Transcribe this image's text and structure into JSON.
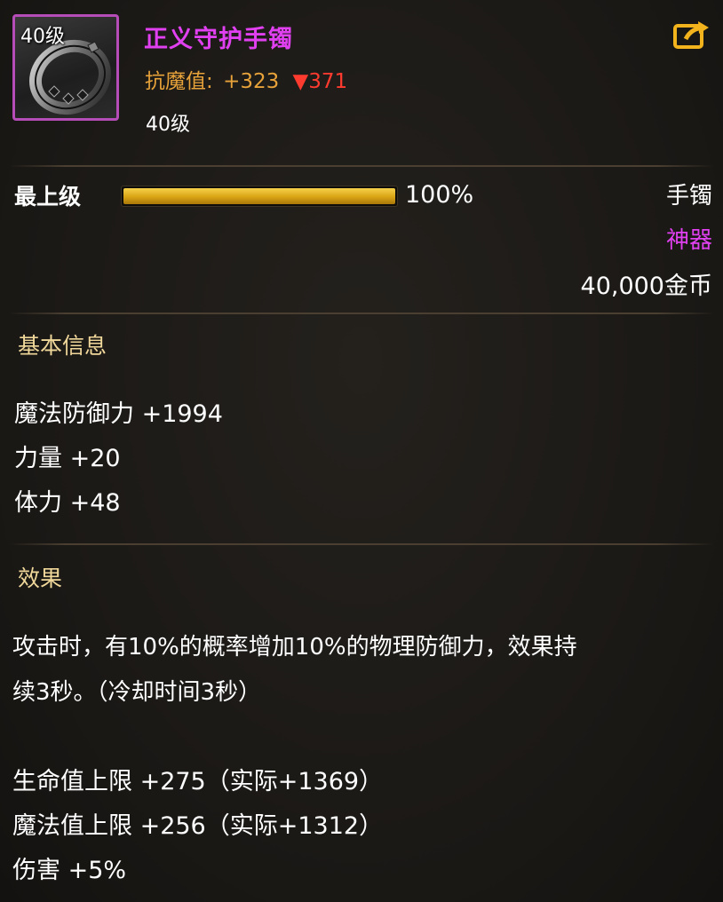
{
  "item": {
    "icon_level": "40级",
    "name": "正义守护手镯",
    "stat_label": "抗魔值:",
    "stat_value": "+323",
    "stat_diff": "▼371",
    "level": "40级",
    "icon": "bracelet-icon"
  },
  "header_actions": {
    "share_icon": "share-icon"
  },
  "grade": {
    "label": "最上级",
    "percent_text": "100%",
    "fill_percent": 100
  },
  "meta": {
    "type": "手镯",
    "rarity": "神器",
    "price": "40,000金币"
  },
  "basic_info": {
    "title": "基本信息",
    "attrs": [
      "魔法防御力 +1994",
      "力量 +20",
      "体力 +48"
    ]
  },
  "effect": {
    "title": "效果",
    "line1": "攻击时，有10%的概率增加10%的物理防御力，效果持",
    "line2": "续3秒。（冷却时间3秒）",
    "bonuses": [
      "生命值上限 +275（实际+1369）",
      "魔法值上限 +256（实际+1312）",
      "伤害 +5%"
    ]
  },
  "colors": {
    "item_name": "#e040f0",
    "stat": "#e7a23a",
    "stat_down": "#ff3b2f",
    "section_title": "#f0d79a",
    "icon_border": "#b64cb8",
    "bar_fill": "#d9a414"
  }
}
